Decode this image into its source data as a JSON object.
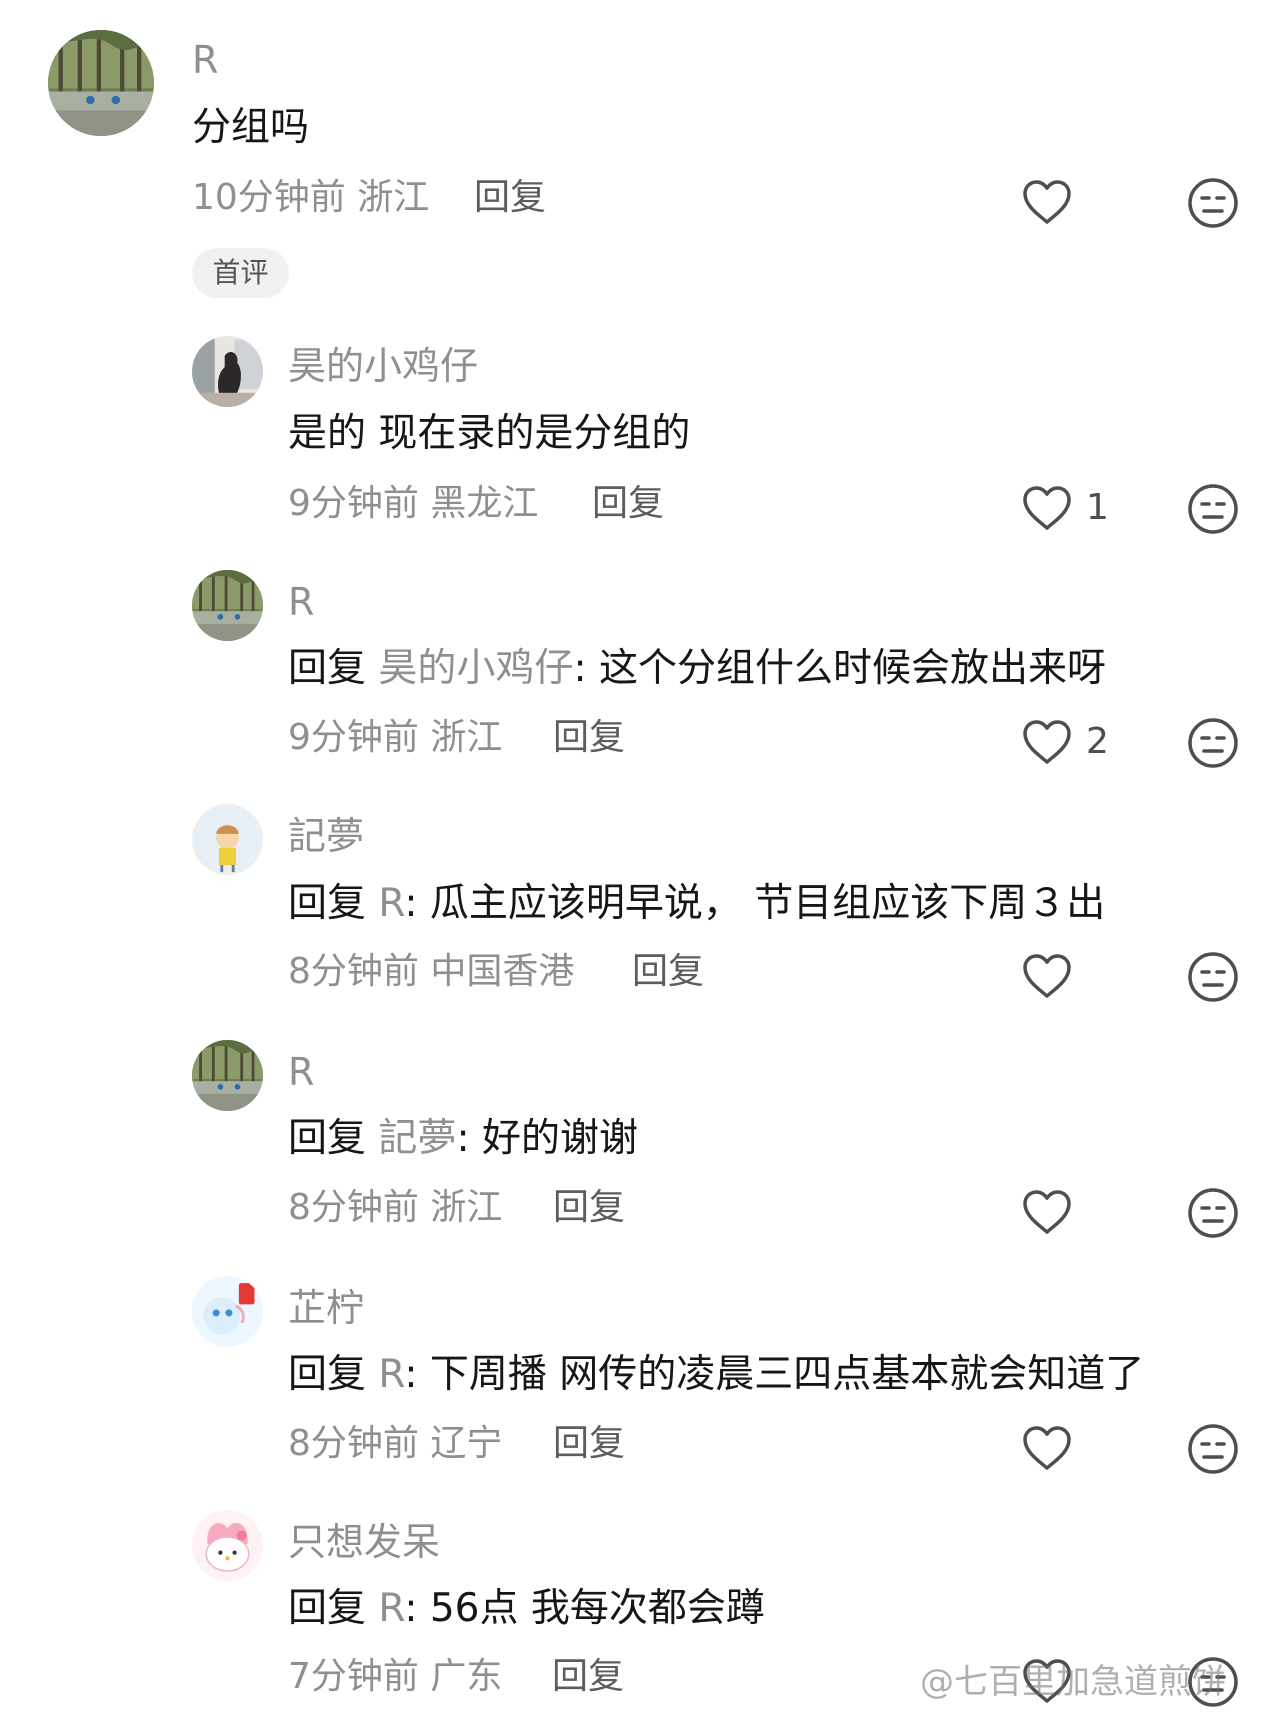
{
  "comments": [
    {
      "username": "R",
      "content": "分组吗",
      "time": "10分钟前",
      "location": "浙江",
      "reply_label": "回复",
      "badge": "首评"
    }
  ],
  "replies": [
    {
      "username": "昊的小鸡仔",
      "content": "是的 现在录的是分组的",
      "time": "9分钟前",
      "location": "黑龙江",
      "reply_label": "回复",
      "like_count": "1"
    },
    {
      "username": "R",
      "prefix": "回复",
      "target": "昊的小鸡仔",
      "text": ": 这个分组什么时候会放出来呀",
      "time": "9分钟前",
      "location": "浙江",
      "reply_label": "回复",
      "like_count": "2"
    },
    {
      "username": "記夢",
      "prefix": "回复",
      "target": "R",
      "text": ": 瓜主应该明早说， 节目组应该下周３出",
      "time": "8分钟前",
      "location": "中国香港",
      "reply_label": "回复"
    },
    {
      "username": "R",
      "prefix": "回复",
      "target": "記夢",
      "text": ": 好的谢谢",
      "time": "8分钟前",
      "location": "浙江",
      "reply_label": "回复"
    },
    {
      "username": "芷柠",
      "prefix": "回复",
      "target": "R",
      "text": ": 下周播 网传的凌晨三四点基本就会知道了",
      "time": "8分钟前",
      "location": "辽宁",
      "reply_label": "回复"
    },
    {
      "username": "只想发呆",
      "prefix": "回复",
      "target": "R",
      "text": ": 56点 我每次都会蹲",
      "time": "7分钟前",
      "location": "广东",
      "reply_label": "回复"
    }
  ],
  "icons": {
    "like": "heart-outline-icon",
    "dislike": "meh-face-icon"
  },
  "watermark": "@七百里加急道煎饼",
  "colors": {
    "text": "#161616",
    "muted": "#8f8f8f",
    "icon": "#4e4e4e",
    "badge_bg": "#f1f1f1"
  }
}
